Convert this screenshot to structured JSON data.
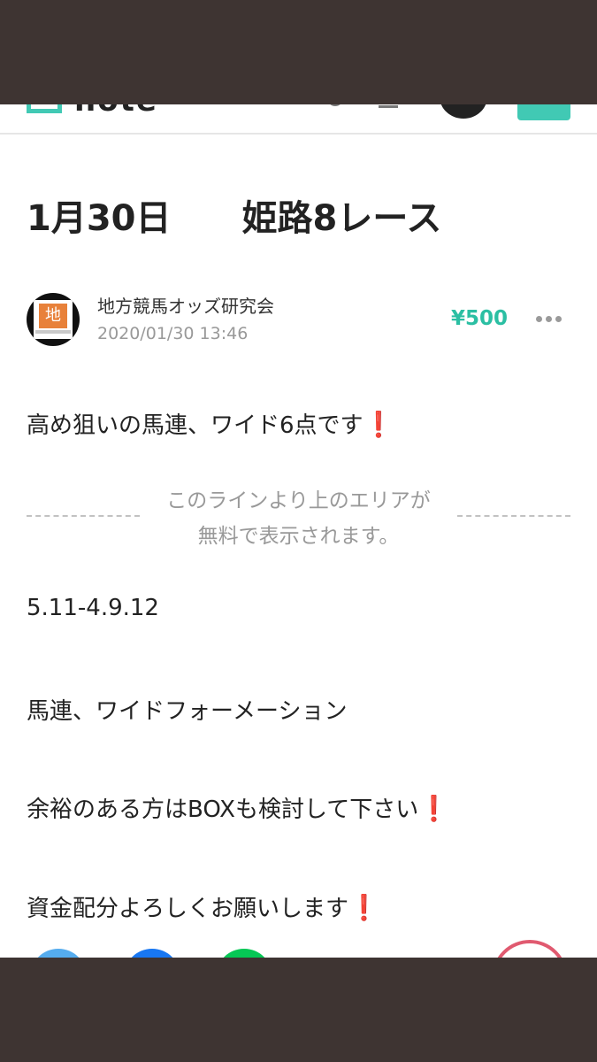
{
  "header": {
    "logo_text": "note"
  },
  "article": {
    "title": "1月30日　　姫路8レース",
    "author": {
      "name": "地方競馬オッズ研究会",
      "avatar_glyph": "地"
    },
    "date": "2020/01/30 13:46",
    "price": "¥500",
    "paragraphs": [
      {
        "text": "高め狙いの馬連、ワイド6点です",
        "mark": "❗"
      },
      {
        "text": "5.11-4.9.12",
        "mark": ""
      },
      {
        "text": "馬連、ワイドフォーメーション",
        "mark": ""
      },
      {
        "text": "余裕のある方はBOXも検討して下さい",
        "mark": "❗"
      },
      {
        "text": "資金配分よろしくお願いします",
        "mark": "❗"
      }
    ],
    "paywall_notice": {
      "line1": "このラインより上のエリアが",
      "line2": "無料で表示されます。"
    }
  },
  "colors": {
    "accent": "#41c9b4",
    "price": "#2bbfa3",
    "exclamation": "#e02020",
    "frame": "#3e3432",
    "share_twitter": "#55acee",
    "share_facebook": "#1877f2",
    "share_line": "#06c755",
    "like": "#e05a70"
  },
  "icons": {
    "more": "more-horizontal-icon",
    "search": "search-icon",
    "bell": "bell-icon"
  }
}
